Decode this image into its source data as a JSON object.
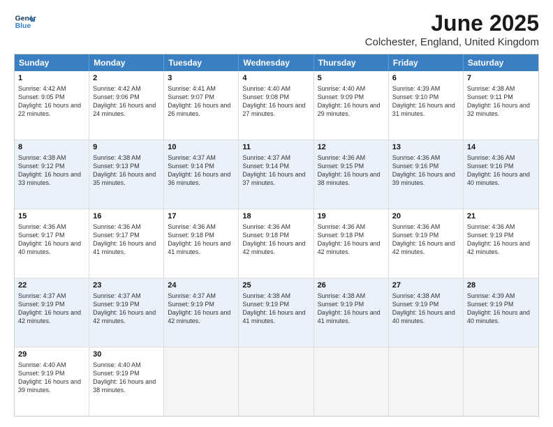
{
  "logo": {
    "line1": "General",
    "line2": "Blue"
  },
  "title": "June 2025",
  "subtitle": "Colchester, England, United Kingdom",
  "days": [
    "Sunday",
    "Monday",
    "Tuesday",
    "Wednesday",
    "Thursday",
    "Friday",
    "Saturday"
  ],
  "weeks": [
    [
      {
        "day": "1",
        "sunrise": "4:42 AM",
        "sunset": "9:05 PM",
        "daylight": "16 hours and 22 minutes."
      },
      {
        "day": "2",
        "sunrise": "4:42 AM",
        "sunset": "9:06 PM",
        "daylight": "16 hours and 24 minutes."
      },
      {
        "day": "3",
        "sunrise": "4:41 AM",
        "sunset": "9:07 PM",
        "daylight": "16 hours and 26 minutes."
      },
      {
        "day": "4",
        "sunrise": "4:40 AM",
        "sunset": "9:08 PM",
        "daylight": "16 hours and 27 minutes."
      },
      {
        "day": "5",
        "sunrise": "4:40 AM",
        "sunset": "9:09 PM",
        "daylight": "16 hours and 29 minutes."
      },
      {
        "day": "6",
        "sunrise": "4:39 AM",
        "sunset": "9:10 PM",
        "daylight": "16 hours and 31 minutes."
      },
      {
        "day": "7",
        "sunrise": "4:38 AM",
        "sunset": "9:11 PM",
        "daylight": "16 hours and 32 minutes."
      }
    ],
    [
      {
        "day": "8",
        "sunrise": "4:38 AM",
        "sunset": "9:12 PM",
        "daylight": "16 hours and 33 minutes."
      },
      {
        "day": "9",
        "sunrise": "4:38 AM",
        "sunset": "9:13 PM",
        "daylight": "16 hours and 35 minutes."
      },
      {
        "day": "10",
        "sunrise": "4:37 AM",
        "sunset": "9:14 PM",
        "daylight": "16 hours and 36 minutes."
      },
      {
        "day": "11",
        "sunrise": "4:37 AM",
        "sunset": "9:14 PM",
        "daylight": "16 hours and 37 minutes."
      },
      {
        "day": "12",
        "sunrise": "4:36 AM",
        "sunset": "9:15 PM",
        "daylight": "16 hours and 38 minutes."
      },
      {
        "day": "13",
        "sunrise": "4:36 AM",
        "sunset": "9:16 PM",
        "daylight": "16 hours and 39 minutes."
      },
      {
        "day": "14",
        "sunrise": "4:36 AM",
        "sunset": "9:16 PM",
        "daylight": "16 hours and 40 minutes."
      }
    ],
    [
      {
        "day": "15",
        "sunrise": "4:36 AM",
        "sunset": "9:17 PM",
        "daylight": "16 hours and 40 minutes."
      },
      {
        "day": "16",
        "sunrise": "4:36 AM",
        "sunset": "9:17 PM",
        "daylight": "16 hours and 41 minutes."
      },
      {
        "day": "17",
        "sunrise": "4:36 AM",
        "sunset": "9:18 PM",
        "daylight": "16 hours and 41 minutes."
      },
      {
        "day": "18",
        "sunrise": "4:36 AM",
        "sunset": "9:18 PM",
        "daylight": "16 hours and 42 minutes."
      },
      {
        "day": "19",
        "sunrise": "4:36 AM",
        "sunset": "9:18 PM",
        "daylight": "16 hours and 42 minutes."
      },
      {
        "day": "20",
        "sunrise": "4:36 AM",
        "sunset": "9:19 PM",
        "daylight": "16 hours and 42 minutes."
      },
      {
        "day": "21",
        "sunrise": "4:36 AM",
        "sunset": "9:19 PM",
        "daylight": "16 hours and 42 minutes."
      }
    ],
    [
      {
        "day": "22",
        "sunrise": "4:37 AM",
        "sunset": "9:19 PM",
        "daylight": "16 hours and 42 minutes."
      },
      {
        "day": "23",
        "sunrise": "4:37 AM",
        "sunset": "9:19 PM",
        "daylight": "16 hours and 42 minutes."
      },
      {
        "day": "24",
        "sunrise": "4:37 AM",
        "sunset": "9:19 PM",
        "daylight": "16 hours and 42 minutes."
      },
      {
        "day": "25",
        "sunrise": "4:38 AM",
        "sunset": "9:19 PM",
        "daylight": "16 hours and 41 minutes."
      },
      {
        "day": "26",
        "sunrise": "4:38 AM",
        "sunset": "9:19 PM",
        "daylight": "16 hours and 41 minutes."
      },
      {
        "day": "27",
        "sunrise": "4:38 AM",
        "sunset": "9:19 PM",
        "daylight": "16 hours and 40 minutes."
      },
      {
        "day": "28",
        "sunrise": "4:39 AM",
        "sunset": "9:19 PM",
        "daylight": "16 hours and 40 minutes."
      }
    ],
    [
      {
        "day": "29",
        "sunrise": "4:40 AM",
        "sunset": "9:19 PM",
        "daylight": "16 hours and 39 minutes."
      },
      {
        "day": "30",
        "sunrise": "4:40 AM",
        "sunset": "9:19 PM",
        "daylight": "16 hours and 38 minutes."
      },
      null,
      null,
      null,
      null,
      null
    ]
  ],
  "labels": {
    "sunrise_prefix": "Sunrise: ",
    "sunset_prefix": "Sunset: ",
    "daylight_prefix": "Daylight: "
  }
}
